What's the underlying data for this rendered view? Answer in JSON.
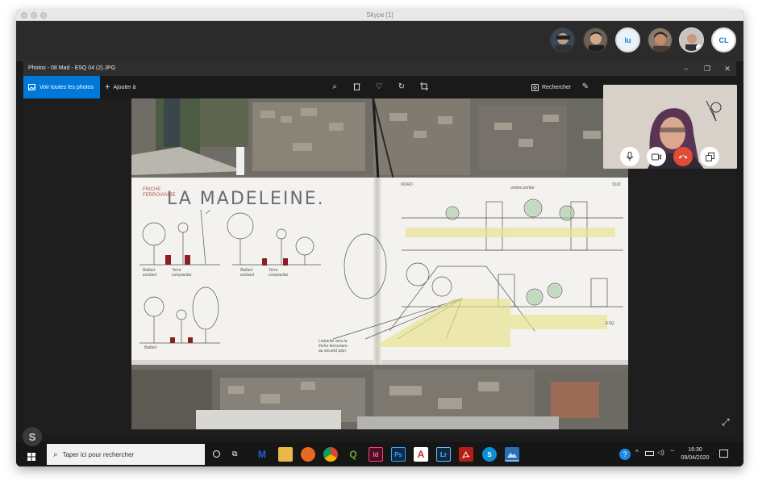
{
  "mac_window": {
    "title": "Skype [1]"
  },
  "participants": [
    {
      "name": "participant-1",
      "type": "photo"
    },
    {
      "name": "participant-2",
      "type": "photo"
    },
    {
      "name": "participant-lu",
      "type": "initials",
      "initials": "lu"
    },
    {
      "name": "participant-4",
      "type": "photo"
    },
    {
      "name": "participant-5",
      "type": "photo"
    },
    {
      "name": "participant-cl",
      "type": "initials",
      "initials": "CL"
    }
  ],
  "photos_app": {
    "title": "Photos - 08 Mad - ESQ 04 (2).JPG",
    "window_controls": {
      "minimize": "–",
      "restore": "❐",
      "close": "✕"
    },
    "toolbar": {
      "see_all_label": "Voir toutes les photos",
      "add_to_label": "Ajouter à",
      "search_label": "Rechercher",
      "more_label": "···"
    }
  },
  "sketch": {
    "title": "LA MADELEINE.",
    "subtitle": "FRICHE\nFERROVIAIRE",
    "north_label": "NORD",
    "south_label": "SUD",
    "notes": [
      "Ballast\nexistant",
      "Terre\ncompactée",
      "Ballast\nexistant",
      "Terre\ncompactée",
      "Ballast",
      "Linéarité vers la\nfriche ferroviaire\nau second plan",
      "ESQ",
      "ombre portée"
    ]
  },
  "call_controls": {
    "mic": "mic-icon",
    "video": "video-icon",
    "hangup": "hangup-icon",
    "switch": "switch-window-icon"
  },
  "colors": {
    "accent_blue": "#0078d7",
    "hangup_red": "#e24b36",
    "taskbar": "#161616"
  },
  "taskbar": {
    "search_placeholder": "Taper ici pour rechercher",
    "apps": [
      {
        "name": "outlook",
        "label": "M",
        "color": "#1a62d6"
      },
      {
        "name": "file-explorer",
        "label": "",
        "color": "#e9b84a"
      },
      {
        "name": "firefox",
        "label": "",
        "color": "#e66b1f"
      },
      {
        "name": "chrome",
        "label": "",
        "color": "#3ea14b"
      },
      {
        "name": "qgis",
        "label": "Q",
        "color": "#6aa33a"
      },
      {
        "name": "indesign",
        "label": "Id",
        "color": "#4d0d25"
      },
      {
        "name": "photoshop",
        "label": "Ps",
        "color": "#0e2b49"
      },
      {
        "name": "autocad",
        "label": "A",
        "color": "#c9282d"
      },
      {
        "name": "lightroom",
        "label": "Lr",
        "color": "#0c2b44"
      },
      {
        "name": "acrobat",
        "label": "",
        "color": "#b31e17"
      },
      {
        "name": "skype",
        "label": "S",
        "color": "#0a8fd8"
      },
      {
        "name": "photos",
        "label": "",
        "color": "#2a6fb4"
      }
    ],
    "time": "16:30",
    "date": "09/04/2020",
    "badge_letter": "S"
  }
}
